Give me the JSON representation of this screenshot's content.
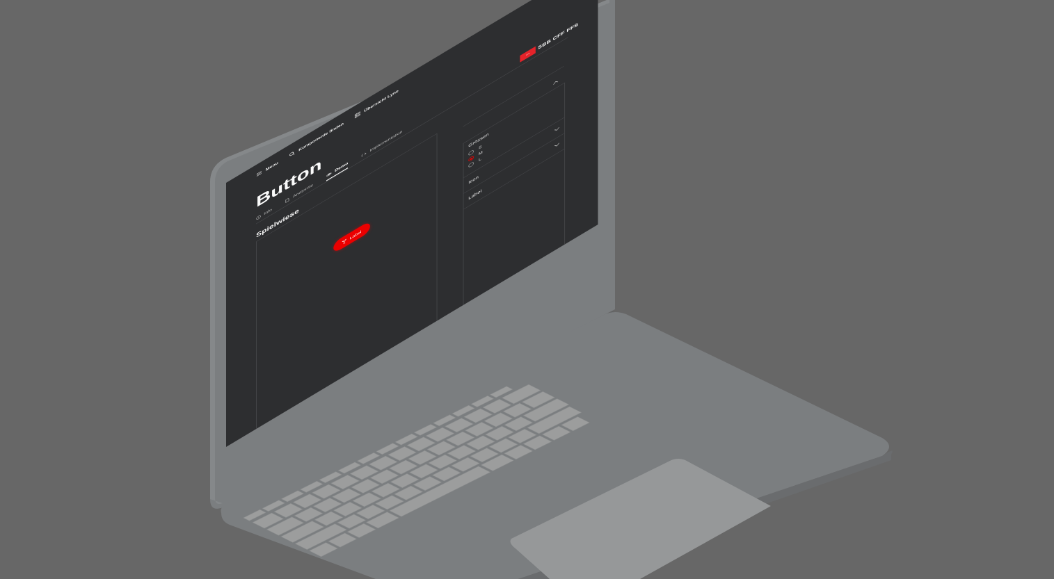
{
  "topnav": {
    "menu_label": "Menu",
    "find_label": "Komponente finden",
    "overview_label": "Übersicht Lyne"
  },
  "logo": {
    "text": "SBB CFF FFS"
  },
  "page": {
    "title": "Button",
    "tabs": [
      {
        "label": "Info",
        "icon": "info-icon",
        "active": false
      },
      {
        "label": "Anatomie",
        "icon": "document-icon",
        "active": false
      },
      {
        "label": "Demo",
        "icon": "eye-icon",
        "active": true
      },
      {
        "label": "Implementation",
        "icon": "code-icon",
        "active": false
      }
    ],
    "section_title": "Spielwiese",
    "demo_button_label": "Label"
  },
  "panel": {
    "sizes_label": "Grössen",
    "sizes": [
      {
        "label": "S",
        "checked": false
      },
      {
        "label": "M",
        "checked": true
      },
      {
        "label": "L",
        "checked": false
      }
    ],
    "icon_label": "Icon",
    "label_label": "Label"
  },
  "colors": {
    "accent": "#eb0000",
    "screen_bg": "#2d2e30",
    "background": "#676767",
    "device": "#7c7e80",
    "keys": "#9c9d9d"
  }
}
